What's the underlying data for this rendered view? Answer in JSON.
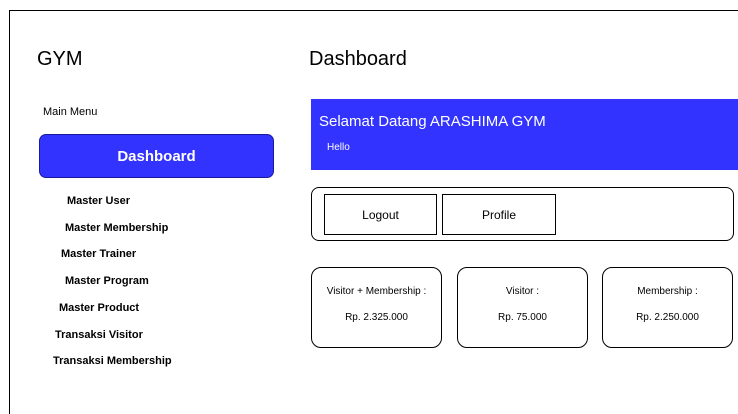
{
  "app": {
    "title": "GYM"
  },
  "page": {
    "title": "Dashboard"
  },
  "sidebar": {
    "heading": "Main Menu",
    "active_label": "Dashboard",
    "items": [
      {
        "label": "Master User"
      },
      {
        "label": "Master Membership"
      },
      {
        "label": "Master Trainer"
      },
      {
        "label": "Master Program"
      },
      {
        "label": "Master Product"
      },
      {
        "label": "Transaksi Visitor"
      },
      {
        "label": "Transaksi Membership"
      }
    ]
  },
  "banner": {
    "title": "Selamat Datang ARASHIMA GYM",
    "subtitle": "Hello",
    "color": "#3333ff"
  },
  "actions": {
    "logout_label": "Logout",
    "profile_label": "Profile"
  },
  "stats": [
    {
      "label": "Visitor + Membership :",
      "value": "Rp. 2.325.000"
    },
    {
      "label": "Visitor :",
      "value": "Rp. 75.000"
    },
    {
      "label": "Membership :",
      "value": "Rp. 2.250.000"
    }
  ]
}
